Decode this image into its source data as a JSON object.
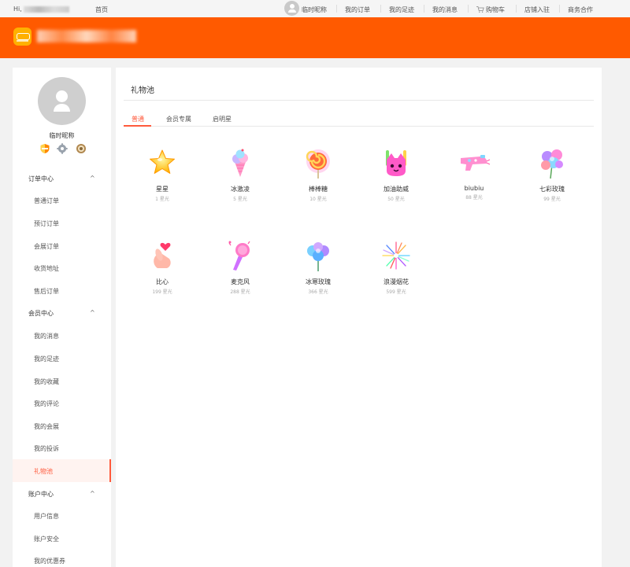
{
  "topbar": {
    "greeting": "Hi,",
    "home": "首页",
    "nickname": "临时昵称",
    "links": [
      "我的订单",
      "我的足迹",
      "我的消息",
      "购物车",
      "店铺入驻",
      "商务合作"
    ]
  },
  "sidebar": {
    "nickname": "临时昵称",
    "groups": [
      {
        "label": "订单中心",
        "items": [
          "普通订单",
          "预订订单",
          "会展订单",
          "收货地址",
          "售后订单"
        ]
      },
      {
        "label": "会员中心",
        "items": [
          "我的消息",
          "我的足迹",
          "我的收藏",
          "我的评论",
          "我的会展",
          "我的投诉",
          "礼物池"
        ]
      },
      {
        "label": "账户中心",
        "items": [
          "用户信息",
          "账户安全",
          "我的优惠券"
        ]
      }
    ],
    "chevron": "^"
  },
  "main": {
    "title": "礼物池",
    "tabs": [
      "普通",
      "会员专属",
      "启明星"
    ],
    "gifts": [
      {
        "name": "星星",
        "price": "1 星光",
        "icon": "star-icon"
      },
      {
        "name": "冰激凌",
        "price": "5 星光",
        "icon": "ice-cream-icon"
      },
      {
        "name": "棒棒糖",
        "price": "10 星光",
        "icon": "lollipop-icon"
      },
      {
        "name": "加油助威",
        "price": "50 星光",
        "icon": "cheer-icon"
      },
      {
        "name": "biubiu",
        "price": "88 星光",
        "icon": "toy-gun-icon"
      },
      {
        "name": "七彩玫瑰",
        "price": "99 星光",
        "icon": "rainbow-rose-icon"
      },
      {
        "name": "比心",
        "price": "199 星光",
        "icon": "finger-heart-icon"
      },
      {
        "name": "麦克风",
        "price": "288 星光",
        "icon": "microphone-icon"
      },
      {
        "name": "冰寒玫瑰",
        "price": "366 星光",
        "icon": "ice-rose-icon"
      },
      {
        "name": "浪漫烟花",
        "price": "599 星光",
        "icon": "fireworks-icon"
      }
    ]
  },
  "colors": {
    "brand": "#ff5a00",
    "accent": "#ff5a3c"
  }
}
